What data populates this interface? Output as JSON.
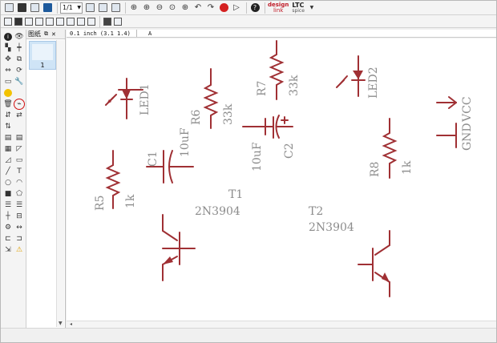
{
  "toolbar": {
    "page_select": "1/1",
    "brand_left_top": "design",
    "brand_left_bottom": "link",
    "brand_right_top": "LTC",
    "brand_right_bottom": "spice"
  },
  "thumbs": {
    "title": "图纸",
    "page_number": "1"
  },
  "cmdbar": {
    "coordinate": "0.1 inch (3.1 1.4)",
    "command": "A"
  },
  "schematic": {
    "labels": {
      "led1": "LED1",
      "led2": "LED2",
      "r5": "R5",
      "r5_val": "1k",
      "r6": "R6",
      "r6_val": "33k",
      "r7": "R7",
      "r7_val": "33k",
      "r8": "R8",
      "r8_val": "1k",
      "c1": "C1",
      "c1_val": "10uF",
      "c2": "C2",
      "c2_val": "10uF",
      "t1": "T1",
      "t1_val": "2N3904",
      "t2": "T2",
      "t2_val": "2N3904",
      "gnd": "GND",
      "vcc": "VCC"
    },
    "colors": {
      "symbol": "#a03034",
      "label": "#8c8c8c"
    }
  },
  "palette": {
    "highlighted_tool_color": "#d01010"
  }
}
